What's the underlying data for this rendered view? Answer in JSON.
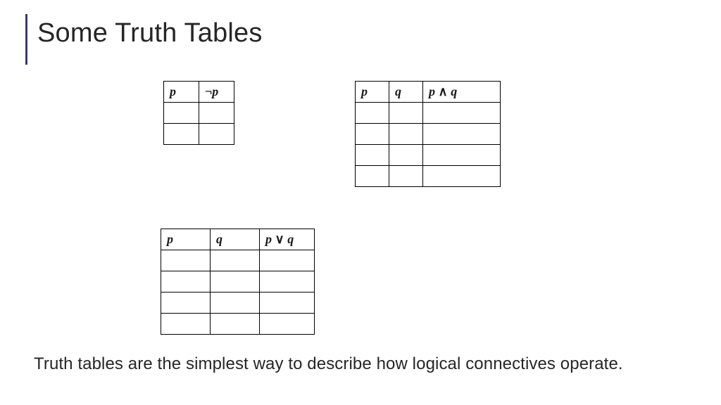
{
  "title": "Some Truth Tables",
  "tables": {
    "neg": {
      "headers": [
        "p",
        "¬p"
      ],
      "rows": [
        [
          "",
          ""
        ],
        [
          "",
          ""
        ]
      ]
    },
    "and": {
      "headers": [
        "p",
        "q",
        "p ∧ q"
      ],
      "rows": [
        [
          "",
          "",
          ""
        ],
        [
          "",
          "",
          ""
        ],
        [
          "",
          "",
          ""
        ],
        [
          "",
          "",
          ""
        ]
      ]
    },
    "or": {
      "headers": [
        "p",
        "q",
        "p ∨ q"
      ],
      "rows": [
        [
          "",
          "",
          ""
        ],
        [
          "",
          "",
          ""
        ],
        [
          "",
          "",
          ""
        ],
        [
          "",
          "",
          ""
        ]
      ]
    }
  },
  "caption": "Truth tables are the simplest way to describe how logical connectives operate."
}
